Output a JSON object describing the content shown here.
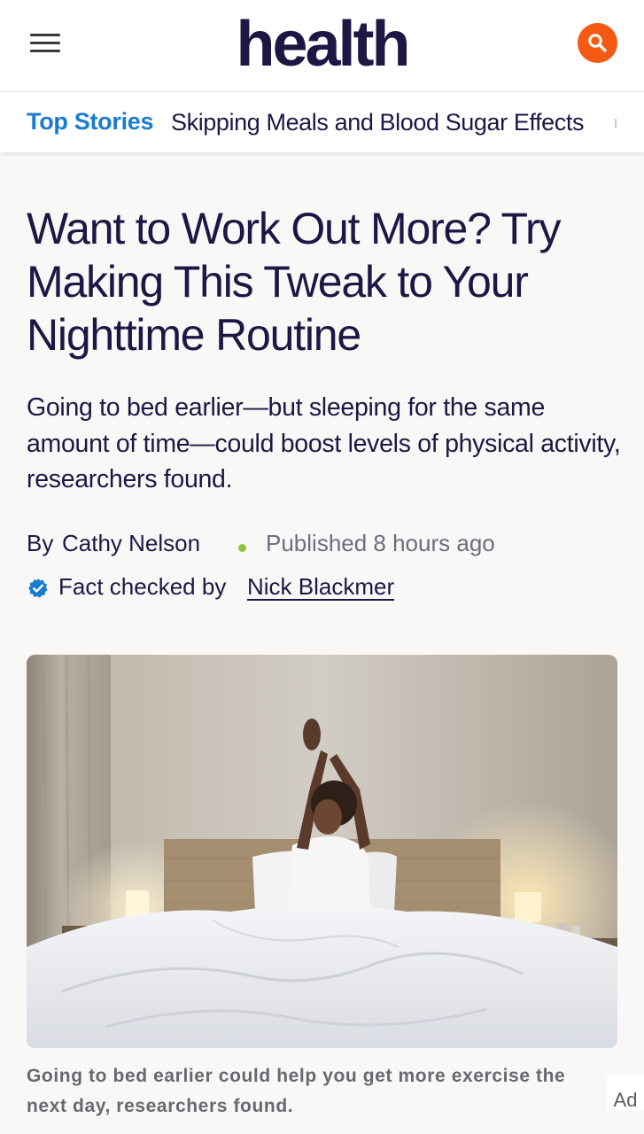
{
  "header": {
    "logo": "health",
    "menu_icon": "hamburger-menu-icon",
    "search_icon": "search-icon",
    "accent_color": "#f45a14"
  },
  "top_stories": {
    "label": "Top Stories",
    "link": "Skipping Meals and Blood Sugar Effects",
    "label_color": "#1a7ccf"
  },
  "article": {
    "headline": "Want to Work Out More? Try Making This Tweak to Your Nighttime Routine",
    "dek": "Going to bed earlier—but sleeping for the same amount of time—could boost levels of physical activity, researchers found.",
    "byline_prefix": "By",
    "author": "Cathy Nelson",
    "published": "Published 8 hours ago",
    "fact_check_label": "Fact checked by",
    "fact_checker": "Nick Blackmer",
    "fact_check_icon": "verified-badge-icon",
    "image_alt": "Woman stretching her arms above her head while sitting up in bed",
    "caption": "Going to bed earlier could help you get more exercise the next day, researchers found."
  },
  "ad": {
    "label": "Ad"
  }
}
